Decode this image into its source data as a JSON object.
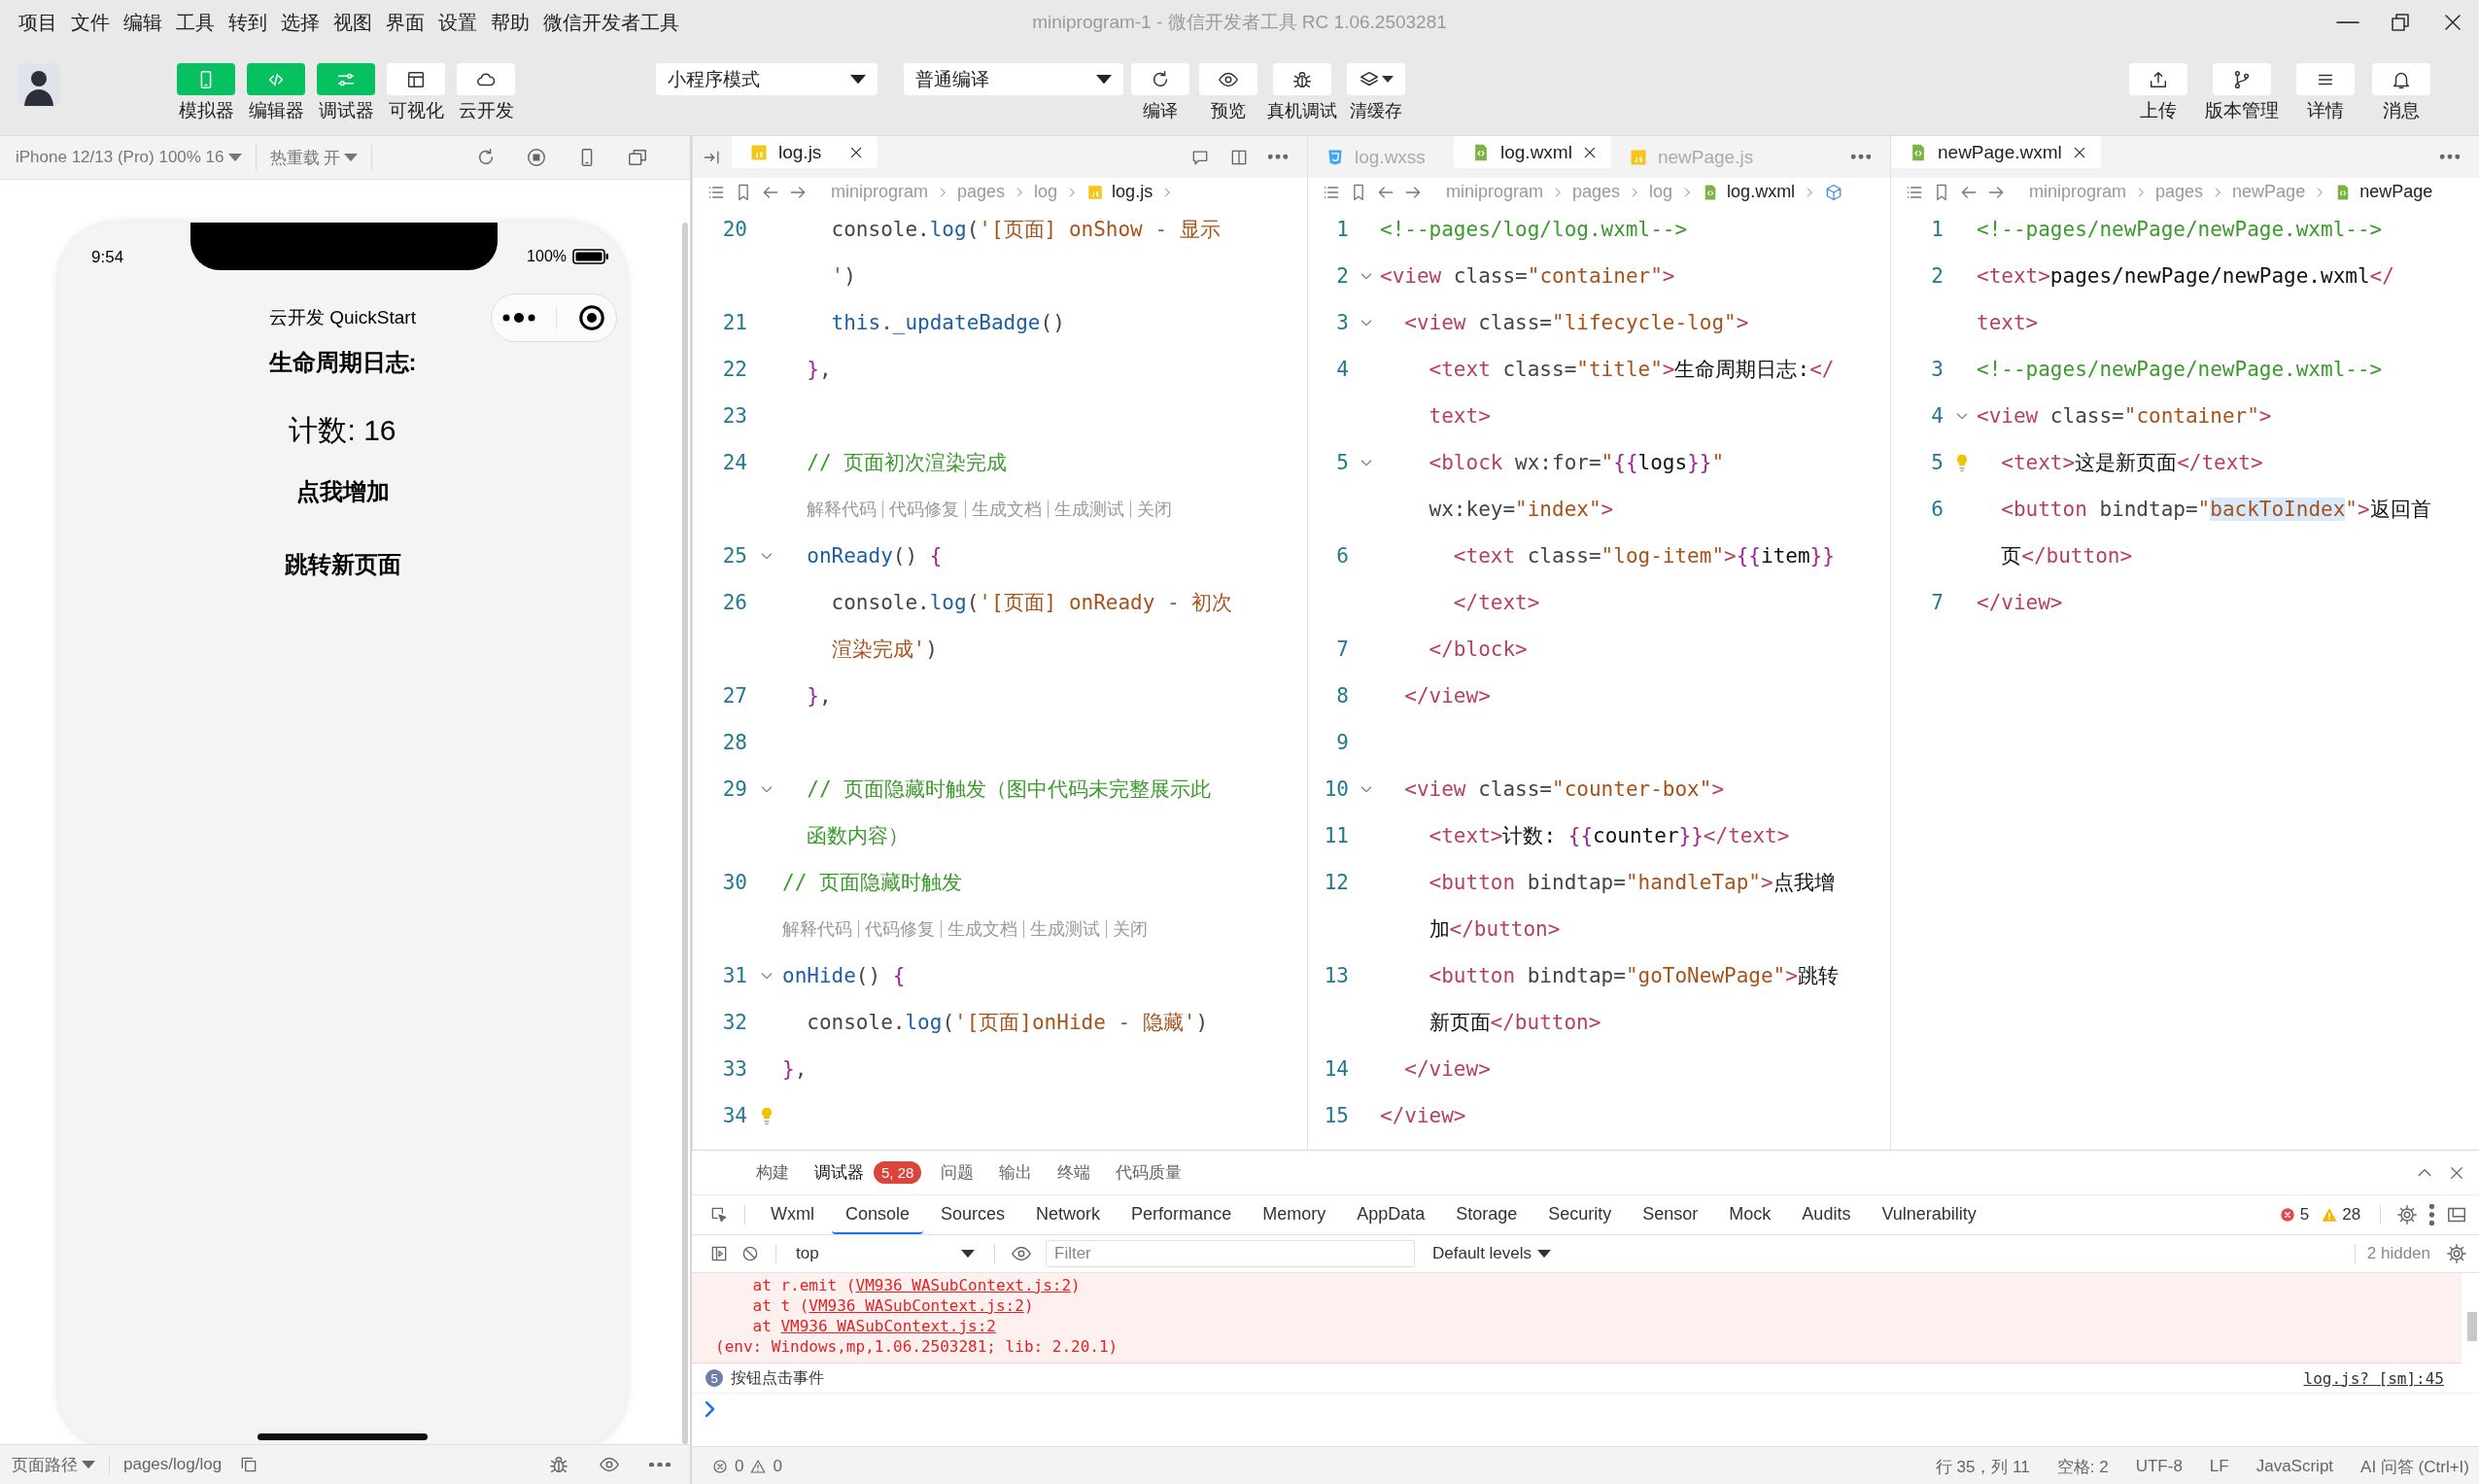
{
  "window": {
    "title": "miniprogram-1 - 微信开发者工具 RC 1.06.2503281"
  },
  "menu": [
    "项目",
    "文件",
    "编辑",
    "工具",
    "转到",
    "选择",
    "视图",
    "界面",
    "设置",
    "帮助",
    "微信开发者工具"
  ],
  "toolbar": {
    "view_toggles": [
      {
        "label": "模拟器",
        "kind": "phone",
        "on": true
      },
      {
        "label": "编辑器",
        "kind": "code",
        "on": true
      },
      {
        "label": "调试器",
        "kind": "sliders",
        "on": true
      },
      {
        "label": "可视化",
        "kind": "layout",
        "on": false
      },
      {
        "label": "云开发",
        "kind": "cloud",
        "on": false
      }
    ],
    "mode_select": "小程序模式",
    "compile_select": "普通编译",
    "actions": [
      {
        "label": "编译",
        "kind": "refresh",
        "dropdown": false
      },
      {
        "label": "预览",
        "kind": "eye",
        "dropdown": false
      },
      {
        "label": "真机调试",
        "kind": "bug",
        "dropdown": false
      },
      {
        "label": "清缓存",
        "kind": "layers",
        "dropdown": true
      }
    ],
    "right_actions": [
      {
        "label": "上传",
        "kind": "upload"
      },
      {
        "label": "版本管理",
        "kind": "branch"
      },
      {
        "label": "详情",
        "kind": "list"
      },
      {
        "label": "消息",
        "kind": "bell"
      }
    ]
  },
  "simulator": {
    "device": "iPhone 12/13 (Pro) 100% 16",
    "hot_reload": "热重载 开",
    "time": "9:54",
    "battery": "100%",
    "nav_title": "云开发 QuickStart",
    "content": [
      {
        "kind": "title",
        "text": "生命周期日志:"
      },
      {
        "kind": "count",
        "text": "计数: 16"
      },
      {
        "kind": "button",
        "text": "点我增加"
      },
      {
        "kind": "button",
        "text": "跳转新页面"
      }
    ],
    "path_label": "页面路径",
    "path": "pages/log/log"
  },
  "editors": [
    {
      "sidebar_toggle": true,
      "tabs": [
        {
          "name": "log.js",
          "kind": "js",
          "selected": true
        }
      ],
      "actions": [
        {
          "kind": "comment"
        },
        {
          "kind": "split"
        },
        {
          "kind": "more"
        }
      ],
      "breadcrumb": [
        "miniprogram",
        "pages",
        "log"
      ],
      "file": {
        "name": "log.js",
        "kind": "js"
      },
      "trail": {
        "kind": "chevron"
      },
      "lines": [
        {
          "kind": "code",
          "num": "20",
          "fold": false,
          "tokens": [
            {
              "text": "    console.",
              "kind": "p"
            },
            {
              "text": "log",
              "kind": "k"
            },
            {
              "text": "(",
              "kind": "p"
            },
            {
              "text": "'[页面] onShow - 显示",
              "kind": "s"
            }
          ]
        },
        {
          "kind": "code",
          "tokens": [
            {
              "text": "    '",
              "kind": "s"
            },
            {
              "text": ")",
              "kind": "p"
            }
          ]
        },
        {
          "kind": "code",
          "num": "21",
          "fold": false,
          "tokens": [
            {
              "text": "    this._updateBadge",
              "kind": "k"
            },
            {
              "text": "()",
              "kind": "p"
            }
          ]
        },
        {
          "kind": "code",
          "num": "22",
          "fold": false,
          "tokens": [
            {
              "text": "  }",
              "kind": "b"
            },
            {
              "text": ",",
              "kind": "p"
            }
          ]
        },
        {
          "kind": "code",
          "num": "23",
          "fold": false
        },
        {
          "kind": "code",
          "num": "24",
          "fold": false,
          "tokens": [
            {
              "text": "  // 页面初次渲染完成",
              "kind": "c"
            }
          ]
        },
        {
          "kind": "lens",
          "indented": true,
          "items": [
            "解释代码",
            "代码修复",
            "生成文档",
            "生成测试",
            "关闭"
          ]
        },
        {
          "kind": "code",
          "num": "25",
          "fold": true,
          "tokens": [
            {
              "text": "  onReady",
              "kind": "k"
            },
            {
              "text": "() ",
              "kind": "p"
            },
            {
              "text": "{",
              "kind": "b"
            }
          ]
        },
        {
          "kind": "code",
          "num": "26",
          "fold": false,
          "tokens": [
            {
              "text": "    console.",
              "kind": "p"
            },
            {
              "text": "log",
              "kind": "k"
            },
            {
              "text": "(",
              "kind": "p"
            },
            {
              "text": "'[页面] onReady - 初次",
              "kind": "s"
            }
          ]
        },
        {
          "kind": "code",
          "tokens": [
            {
              "text": "    渲染完成'",
              "kind": "s"
            },
            {
              "text": ")",
              "kind": "p"
            }
          ]
        },
        {
          "kind": "code",
          "num": "27",
          "fold": false,
          "tokens": [
            {
              "text": "  }",
              "kind": "b"
            },
            {
              "text": ",",
              "kind": "p"
            }
          ]
        },
        {
          "kind": "code",
          "num": "28",
          "fold": false
        },
        {
          "kind": "code",
          "num": "29",
          "fold": true,
          "tokens": [
            {
              "text": "  // 页面隐藏时触发（图中代码未完整展示此",
              "kind": "c"
            }
          ]
        },
        {
          "kind": "code",
          "tokens": [
            {
              "text": "  函数内容）",
              "kind": "c"
            }
          ]
        },
        {
          "kind": "code",
          "num": "30",
          "fold": false,
          "tokens": [
            {
              "text": "// 页面隐藏时触发",
              "kind": "c"
            }
          ]
        },
        {
          "kind": "lens",
          "indented": false,
          "items": [
            "解释代码",
            "代码修复",
            "生成文档",
            "生成测试",
            "关闭"
          ]
        },
        {
          "kind": "code",
          "num": "31",
          "fold": true,
          "tokens": [
            {
              "text": "onHide",
              "kind": "k"
            },
            {
              "text": "() ",
              "kind": "p"
            },
            {
              "text": "{",
              "kind": "b"
            }
          ]
        },
        {
          "kind": "code",
          "num": "32",
          "fold": false,
          "tokens": [
            {
              "text": "  console.",
              "kind": "p"
            },
            {
              "text": "log",
              "kind": "k"
            },
            {
              "text": "(",
              "kind": "p"
            },
            {
              "text": "'[页面]onHide - 隐藏'",
              "kind": "s"
            },
            {
              "text": ")",
              "kind": "p"
            }
          ]
        },
        {
          "kind": "code",
          "num": "33",
          "fold": false,
          "tokens": [
            {
              "text": "}",
              "kind": "b"
            },
            {
              "text": ",",
              "kind": "p"
            }
          ]
        },
        {
          "kind": "code",
          "num": "34",
          "fold": false,
          "bulb": true
        }
      ]
    },
    {
      "sidebar_toggle": false,
      "tabs": [
        {
          "name": "log.wxss",
          "kind": "wxss",
          "selected": false
        },
        {
          "name": "log.wxml",
          "kind": "wxml",
          "selected": true
        },
        {
          "name": "newPage.js",
          "kind": "js",
          "selected": false
        }
      ],
      "actions": [
        {
          "kind": "more"
        }
      ],
      "breadcrumb": [
        "miniprogram",
        "pages",
        "log"
      ],
      "file": {
        "name": "log.wxml",
        "kind": "wxml"
      },
      "trail": {
        "kind": "symbol"
      },
      "lines": [
        {
          "kind": "code",
          "num": "1",
          "fold": false,
          "tokens": [
            {
              "text": "<!--pages/log/log.wxml-->",
              "kind": "c"
            }
          ]
        },
        {
          "kind": "code",
          "num": "2",
          "fold": true,
          "tokens": [
            {
              "text": "<view",
              "kind": "t"
            },
            {
              "text": " class=",
              "kind": "p"
            },
            {
              "text": "\"container\"",
              "kind": "s"
            },
            {
              "text": ">",
              "kind": "t"
            }
          ]
        },
        {
          "kind": "code",
          "num": "3",
          "fold": true,
          "tokens": [
            {
              "text": "  <view",
              "kind": "t"
            },
            {
              "text": " class=",
              "kind": "p"
            },
            {
              "text": "\"lifecycle-log\"",
              "kind": "s"
            },
            {
              "text": ">",
              "kind": "t"
            }
          ]
        },
        {
          "kind": "code",
          "num": "4",
          "fold": false,
          "tokens": [
            {
              "text": "    <text",
              "kind": "t"
            },
            {
              "text": " class=",
              "kind": "p"
            },
            {
              "text": "\"title\"",
              "kind": "s"
            },
            {
              "text": ">",
              "kind": "t"
            },
            {
              "text": "生命周期日志:",
              "kind": "x"
            },
            {
              "text": "</",
              "kind": "t"
            }
          ]
        },
        {
          "kind": "code",
          "tokens": [
            {
              "text": "    text>",
              "kind": "t"
            }
          ]
        },
        {
          "kind": "code",
          "num": "5",
          "fold": true,
          "tokens": [
            {
              "text": "    <block",
              "kind": "t"
            },
            {
              "text": " wx:for=",
              "kind": "p"
            },
            {
              "text": "\"",
              "kind": "s"
            },
            {
              "text": "{{",
              "kind": "b"
            },
            {
              "text": "logs",
              "kind": "x"
            },
            {
              "text": "}}",
              "kind": "b"
            },
            {
              "text": "\"",
              "kind": "s"
            }
          ]
        },
        {
          "kind": "code",
          "tokens": [
            {
              "text": "    wx:key=",
              "kind": "p"
            },
            {
              "text": "\"index\"",
              "kind": "s"
            },
            {
              "text": ">",
              "kind": "t"
            }
          ]
        },
        {
          "kind": "code",
          "num": "6",
          "fold": false,
          "tokens": [
            {
              "text": "      <text",
              "kind": "t"
            },
            {
              "text": " class=",
              "kind": "p"
            },
            {
              "text": "\"log-item\"",
              "kind": "s"
            },
            {
              "text": ">",
              "kind": "t"
            },
            {
              "text": "{{",
              "kind": "b"
            },
            {
              "text": "item",
              "kind": "x"
            },
            {
              "text": "}}",
              "kind": "b"
            }
          ]
        },
        {
          "kind": "code",
          "tokens": [
            {
              "text": "      </text>",
              "kind": "t"
            }
          ]
        },
        {
          "kind": "code",
          "num": "7",
          "fold": false,
          "tokens": [
            {
              "text": "    </block>",
              "kind": "t"
            }
          ]
        },
        {
          "kind": "code",
          "num": "8",
          "fold": false,
          "tokens": [
            {
              "text": "  </view>",
              "kind": "t"
            }
          ]
        },
        {
          "kind": "code",
          "num": "9",
          "fold": false
        },
        {
          "kind": "code",
          "num": "10",
          "fold": true,
          "tokens": [
            {
              "text": "  <view",
              "kind": "t"
            },
            {
              "text": " class=",
              "kind": "p"
            },
            {
              "text": "\"counter-box\"",
              "kind": "s"
            },
            {
              "text": ">",
              "kind": "t"
            }
          ]
        },
        {
          "kind": "code",
          "num": "11",
          "fold": false,
          "tokens": [
            {
              "text": "    <text>",
              "kind": "t"
            },
            {
              "text": "计数: ",
              "kind": "x"
            },
            {
              "text": "{{",
              "kind": "b"
            },
            {
              "text": "counter",
              "kind": "x"
            },
            {
              "text": "}}",
              "kind": "b"
            },
            {
              "text": "</text>",
              "kind": "t"
            }
          ]
        },
        {
          "kind": "code",
          "num": "12",
          "fold": false,
          "tokens": [
            {
              "text": "    <button",
              "kind": "t"
            },
            {
              "text": " bindtap=",
              "kind": "p"
            },
            {
              "text": "\"handleTap\"",
              "kind": "s"
            },
            {
              "text": ">",
              "kind": "t"
            },
            {
              "text": "点我增",
              "kind": "x"
            }
          ]
        },
        {
          "kind": "code",
          "tokens": [
            {
              "text": "    加",
              "kind": "x"
            },
            {
              "text": "</button>",
              "kind": "t"
            }
          ]
        },
        {
          "kind": "code",
          "num": "13",
          "fold": false,
          "tokens": [
            {
              "text": "    <button",
              "kind": "t"
            },
            {
              "text": " bindtap=",
              "kind": "p"
            },
            {
              "text": "\"goToNewPage\"",
              "kind": "s"
            },
            {
              "text": ">",
              "kind": "t"
            },
            {
              "text": "跳转",
              "kind": "x"
            }
          ]
        },
        {
          "kind": "code",
          "tokens": [
            {
              "text": "    新页面",
              "kind": "x"
            },
            {
              "text": "</button>",
              "kind": "t"
            }
          ]
        },
        {
          "kind": "code",
          "num": "14",
          "fold": false,
          "tokens": [
            {
              "text": "  </view>",
              "kind": "t"
            }
          ]
        },
        {
          "kind": "code",
          "num": "15",
          "fold": false,
          "tokens": [
            {
              "text": "</view>",
              "kind": "t"
            }
          ]
        }
      ]
    },
    {
      "sidebar_toggle": false,
      "tabs": [
        {
          "name": "newPage.wxml",
          "kind": "wxml",
          "selected": true
        }
      ],
      "actions": [
        {
          "kind": "more"
        }
      ],
      "breadcrumb": [
        "miniprogram",
        "pages",
        "newPage"
      ],
      "file": {
        "name": "newPage",
        "kind": "wxml"
      },
      "trail": {
        "kind": "none"
      },
      "lines": [
        {
          "kind": "code",
          "num": "1",
          "fold": false,
          "tokens": [
            {
              "text": "<!--pages/newPage/newPage.wxml-->",
              "kind": "c"
            }
          ]
        },
        {
          "kind": "code",
          "num": "2",
          "fold": false,
          "tokens": [
            {
              "text": "<text>",
              "kind": "t"
            },
            {
              "text": "pages/newPage/newPage.wxml",
              "kind": "x"
            },
            {
              "text": "</",
              "kind": "t"
            }
          ]
        },
        {
          "kind": "code",
          "tokens": [
            {
              "text": "text>",
              "kind": "t"
            }
          ]
        },
        {
          "kind": "code",
          "num": "3",
          "fold": false,
          "tokens": [
            {
              "text": "<!--pages/newPage/newPage.wxml-->",
              "kind": "c"
            }
          ]
        },
        {
          "kind": "code",
          "num": "4",
          "fold": true,
          "tokens": [
            {
              "text": "<view",
              "kind": "t"
            },
            {
              "text": " class=",
              "kind": "p"
            },
            {
              "text": "\"container\"",
              "kind": "s"
            },
            {
              "text": ">",
              "kind": "t"
            }
          ]
        },
        {
          "kind": "code",
          "num": "5",
          "fold": false,
          "bulb": true,
          "tokens": [
            {
              "text": "  <text>",
              "kind": "t"
            },
            {
              "text": "这是新页面",
              "kind": "x"
            },
            {
              "text": "</text>",
              "kind": "t"
            }
          ]
        },
        {
          "kind": "code",
          "num": "6",
          "fold": false,
          "tokens": [
            {
              "text": "  <button",
              "kind": "t"
            },
            {
              "text": " bindtap=",
              "kind": "p"
            },
            {
              "text": "\"",
              "kind": "s"
            },
            {
              "text": "backToIndex",
              "kind": "m"
            },
            {
              "text": "\"",
              "kind": "s"
            },
            {
              "text": ">",
              "kind": "t"
            },
            {
              "text": "返回首",
              "kind": "x"
            }
          ]
        },
        {
          "kind": "code",
          "tokens": [
            {
              "text": "  页",
              "kind": "x"
            },
            {
              "text": "</button>",
              "kind": "t"
            }
          ]
        },
        {
          "kind": "code",
          "num": "7",
          "fold": false,
          "tokens": [
            {
              "text": "</view>",
              "kind": "t"
            }
          ]
        }
      ]
    }
  ],
  "debugger": {
    "panel_tabs": [
      {
        "label": "构建",
        "selected": false
      },
      {
        "label": "调试器",
        "selected": true,
        "badge": "5, 28"
      },
      {
        "label": "问题",
        "selected": false
      },
      {
        "label": "输出",
        "selected": false
      },
      {
        "label": "终端",
        "selected": false
      },
      {
        "label": "代码质量",
        "selected": false
      }
    ],
    "devtools_tabs": [
      {
        "label": "Wxml",
        "selected": false
      },
      {
        "label": "Console",
        "selected": true
      },
      {
        "label": "Sources",
        "selected": false
      },
      {
        "label": "Network",
        "selected": false
      },
      {
        "label": "Performance",
        "selected": false
      },
      {
        "label": "Memory",
        "selected": false
      },
      {
        "label": "AppData",
        "selected": false
      },
      {
        "label": "Storage",
        "selected": false
      },
      {
        "label": "Security",
        "selected": false
      },
      {
        "label": "Sensor",
        "selected": false
      },
      {
        "label": "Mock",
        "selected": false
      },
      {
        "label": "Audits",
        "selected": false
      },
      {
        "label": "Vulnerability",
        "selected": false
      }
    ],
    "errors": "5",
    "warnings": "28",
    "context": "top",
    "filter_placeholder": "Filter",
    "levels": "Default levels",
    "hidden": "2 hidden",
    "messages": [
      {
        "kind": "error",
        "lines": [
          [
            {
              "text": "    at r.emit (",
              "kind": "text"
            },
            {
              "text": "VM936 WASubContext.js:2",
              "kind": "link"
            },
            {
              "text": ")",
              "kind": "text"
            }
          ],
          [
            {
              "text": "    at t (",
              "kind": "text"
            },
            {
              "text": "VM936 WASubContext.js:2",
              "kind": "link"
            },
            {
              "text": ")",
              "kind": "text"
            }
          ],
          [
            {
              "text": "    at ",
              "kind": "text"
            },
            {
              "text": "VM936 WASubContext.js:2",
              "kind": "link"
            }
          ],
          [
            {
              "text": "(env: Windows,mp,1.06.2503281; lib: 2.20.1)",
              "kind": "text"
            }
          ]
        ]
      },
      {
        "kind": "log",
        "count": "5",
        "text": "按钮点击事件",
        "source": "log.js? [sm]:45"
      }
    ]
  },
  "status_bar": {
    "errors": "0",
    "warnings": "0",
    "items": [
      "行 35，列 11",
      "空格: 2",
      "UTF-8",
      "LF",
      "JavaScript",
      "AI 问答 (Ctrl+I)"
    ]
  }
}
